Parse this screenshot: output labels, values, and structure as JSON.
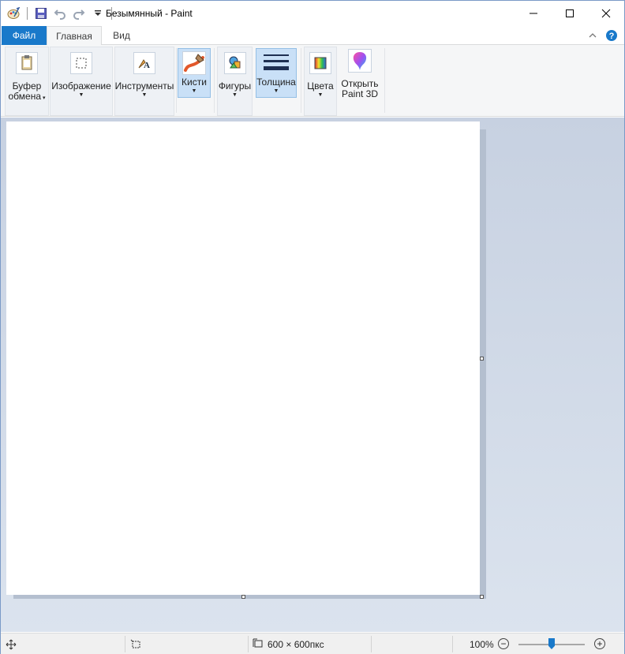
{
  "window": {
    "title": "Безымянный - Paint"
  },
  "tabs": {
    "file": "Файл",
    "home": "Главная",
    "view": "Вид"
  },
  "ribbon": {
    "clipboard": {
      "line1": "Буфер",
      "line2": "обмена"
    },
    "image": "Изображение",
    "tools": "Инструменты",
    "brushes": "Кисти",
    "shapes": "Фигуры",
    "size": "Толщина",
    "colors": "Цвета",
    "paint3d": {
      "line1": "Открыть",
      "line2": "Paint 3D"
    }
  },
  "statusbar": {
    "canvas_size": "600 × 600пкс",
    "zoom": "100%"
  },
  "colors": {
    "accent": "#1979ca",
    "workspace": "#cdd7e5"
  }
}
